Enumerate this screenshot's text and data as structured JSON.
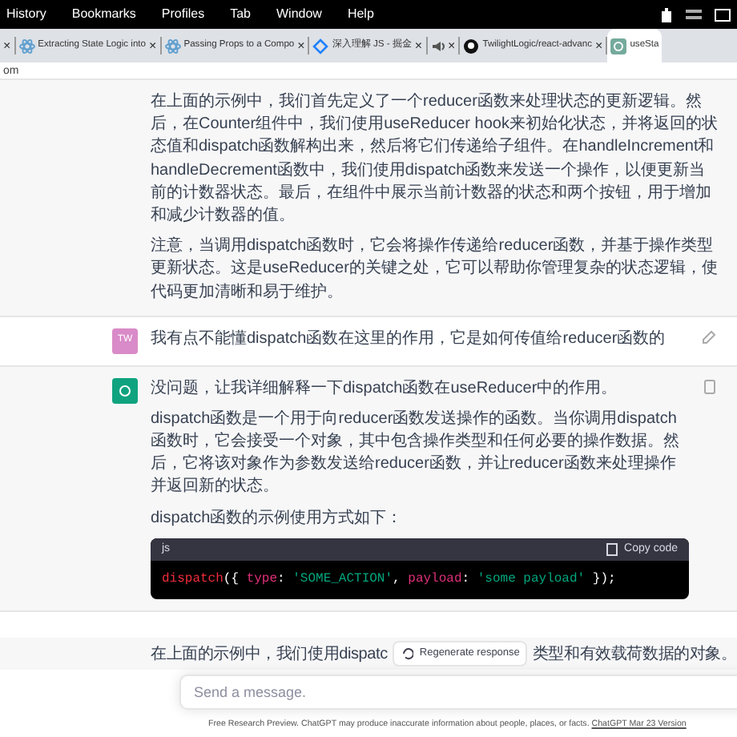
{
  "menubar": {
    "items": [
      "History",
      "Bookmarks",
      "Profiles",
      "Tab",
      "Window",
      "Help"
    ]
  },
  "tabs": [
    {
      "close": "×",
      "selected": false
    },
    {
      "title": "Extracting State Logic into",
      "close": "×",
      "selected": false
    },
    {
      "title": "Passing Props to a Compo",
      "close": "×",
      "selected": false
    },
    {
      "title": "深入理解 JS - 掘金",
      "close": "×",
      "selected": false
    },
    {
      "close": "×",
      "selected": false
    },
    {
      "title": "TwilightLogic/react-advanc",
      "close": "×",
      "selected": false
    },
    {
      "title": "useSta",
      "selected": true
    }
  ],
  "address_bar": {
    "text": "om"
  },
  "messages": [
    {
      "kind": "assistant",
      "paragraphs": [
        "在上面的示例中，我们首先定义了一个reducer函数来处理状态的更新逻辑。然后，在Counter组件中，我们使用useReducer hook来初始化状态，并将返回的状态值和dispatch函数解构出来，然后将它们传递给子组件。在handleIncrement和handleDecrement函数中，我们使用dispatch函数来发送一个操作，以便更新当前的计数器状态。最后，在组件中展示当前计数器的状态和两个按钮，用于增加和减少计数器的值。",
        "注意，当调用dispatch函数时，它会将操作传递给reducer函数，并基于操作类型更新状态。这是useReducer的关键之处，它可以帮助你管理复杂的状态逻辑，使代码更加清晰和易于维护。"
      ]
    },
    {
      "kind": "user",
      "avatar": "TW",
      "paragraphs": [
        "我有点不能懂dispatch函数在这里的作用，它是如何传值给reducer函数的"
      ]
    },
    {
      "kind": "assistant",
      "paragraphs": [
        "没问题，让我详细解释一下dispatch函数在useReducer中的作用。",
        "dispatch函数是一个用于向reducer函数发送操作的函数。当你调用dispatch函数时，它会接受一个对象，其中包含操作类型和任何必要的操作数据。然后，它将该对象作为参数发送给reducer函数，并让reducer函数来处理操作并返回新的状态。",
        "dispatch函数的示例使用方式如下："
      ],
      "code": {
        "language": "js",
        "copy_label": "Copy code",
        "tokens": [
          {
            "kind": "fn",
            "text": "dispatch"
          },
          {
            "kind": "punct",
            "text": "({ "
          },
          {
            "kind": "key",
            "text": "type"
          },
          {
            "kind": "punct",
            "text": ": "
          },
          {
            "kind": "str",
            "text": "'SOME_ACTION'"
          },
          {
            "kind": "punct",
            "text": ", "
          },
          {
            "kind": "key",
            "text": "payload"
          },
          {
            "kind": "punct",
            "text": ": "
          },
          {
            "kind": "str",
            "text": "'some payload'"
          },
          {
            "kind": "punct",
            "text": " });"
          }
        ]
      }
    }
  ],
  "trailing": {
    "left": "在上面的示例中，我们使用dispatc",
    "right": "类型和有效载荷数据的对象。"
  },
  "regenerate_button": "Regenerate response",
  "composer": {
    "placeholder": "Send a message."
  },
  "footer": {
    "text": "Free Research Preview. ChatGPT may produce inaccurate information about people, places, or facts.",
    "link": "ChatGPT Mar 23 Version"
  }
}
